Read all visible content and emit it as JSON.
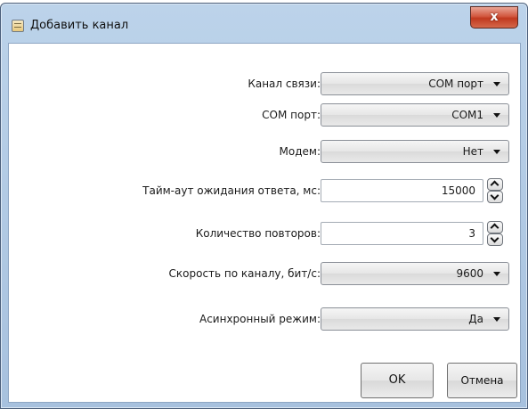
{
  "window": {
    "title": "Добавить канал",
    "close_label": "x"
  },
  "form": {
    "channel": {
      "label": "Канал связи:",
      "value": "COM порт"
    },
    "com_port": {
      "label": "COM порт:",
      "value": "COM1"
    },
    "modem": {
      "label": "Модем:",
      "value": "Нет"
    },
    "timeout": {
      "label": "Тайм-аут ожидания ответа, мс:",
      "value": "15000"
    },
    "retries": {
      "label": "Количество повторов:",
      "value": "3"
    },
    "speed": {
      "label": "Скорость по каналу, бит/с:",
      "value": "9600"
    },
    "async": {
      "label": "Асинхронный режим:",
      "value": "Да"
    }
  },
  "buttons": {
    "ok": "OK",
    "cancel": "Отмена"
  },
  "icons": {
    "app": "dialog-window-icon",
    "close": "close-icon",
    "dropdown": "chevron-down-icon",
    "spin_up": "chevron-up-icon",
    "spin_down": "chevron-down-icon"
  },
  "colors": {
    "titlebar": "#bcd3ea",
    "close_button": "#c0391f",
    "client_bg": "#ffffff"
  }
}
